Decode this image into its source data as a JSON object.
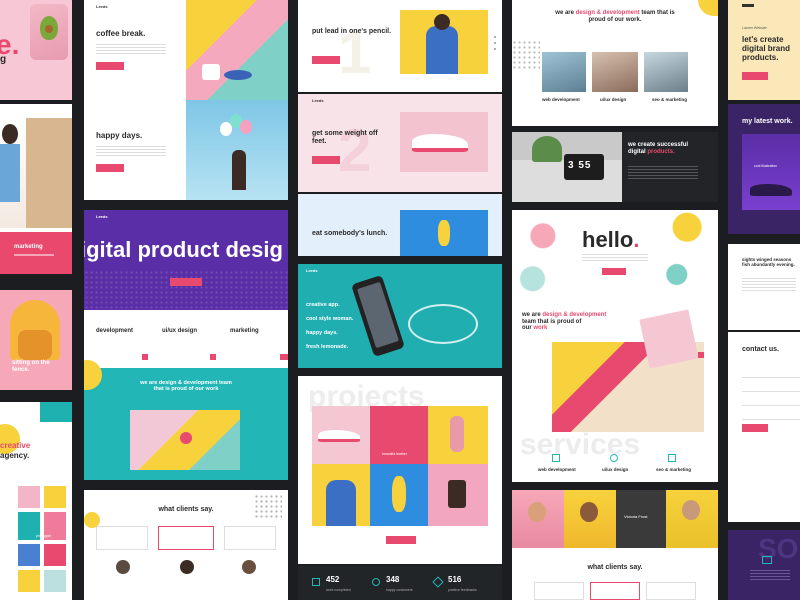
{
  "col1": {
    "c1_word": "e.",
    "c1_word2": "g",
    "c3_service": "marketing",
    "c4_title": "sitting on the fence.",
    "c5_title1": "creative",
    "c5_title2": "agency.",
    "c5_pineapple": "pineapple"
  },
  "col2": {
    "logo": "Leeds",
    "c1_title": "coffee break.",
    "c1_title2": "happy days.",
    "c2_big": "igital product desig",
    "c2_services": [
      "development",
      "ui/ux design",
      "marketing"
    ],
    "c2_tagline": "we are design & development team that is proud of our work",
    "c3_title": "what clients say."
  },
  "col3": {
    "logo": "Leeds",
    "c1_title": "put lead in one's pencil.",
    "c1_num": "1",
    "c2_title": "get some weight off feet.",
    "c2_num": "2",
    "c3_title": "eat somebody's lunch.",
    "c4_lines": [
      "creative app.",
      "cool style woman.",
      "happy days.",
      "fresh lemonade."
    ],
    "c5_watermark": "projects",
    "c5_caption": "beautiful leather",
    "c6_stats": [
      {
        "num": "452",
        "label": "work completed"
      },
      {
        "num": "348",
        "label": "happy customers"
      },
      {
        "num": "516",
        "label": "positive feedbacks"
      }
    ]
  },
  "col4": {
    "c1_tagline_a": "we are ",
    "c1_tagline_b": "design & development",
    "c1_tagline_c": "team that is proud of our work.",
    "c1_services": [
      "web development",
      "ui/ux design",
      "seo & marketing"
    ],
    "c2_title_a": "we create successful",
    "c2_title_b": "digital ",
    "c2_title_c": "products.",
    "c2_clock": "3 55",
    "c3_hello": "hello",
    "c3_tagline_a": "we are ",
    "c3_tagline_b": "design & development",
    "c3_tagline_c": "team that is proud of",
    "c3_tagline_d": "our ",
    "c3_tagline_e": "work",
    "c3_watermark": "services",
    "c3_services": [
      "web development",
      "ui/ux design",
      "seo & marketing"
    ],
    "c4_person": "Victoria Frost",
    "c4_title": "what clients say."
  },
  "col5": {
    "c1_name": "Lauren Webster",
    "c1_title": "let's create digital brand products.",
    "c2_title": "my latest work.",
    "c2_caption": "cool illustration",
    "c3_title": "sights winged seasons fish abundantly evening.",
    "c4_title": "contact us.",
    "c5_watermark": "SO"
  },
  "colors": {
    "accent": "#e84a6f",
    "purple": "#5a2ea6",
    "teal": "#1fb0b0",
    "yellow": "#f7d23c",
    "dark": "#1c1d20"
  }
}
